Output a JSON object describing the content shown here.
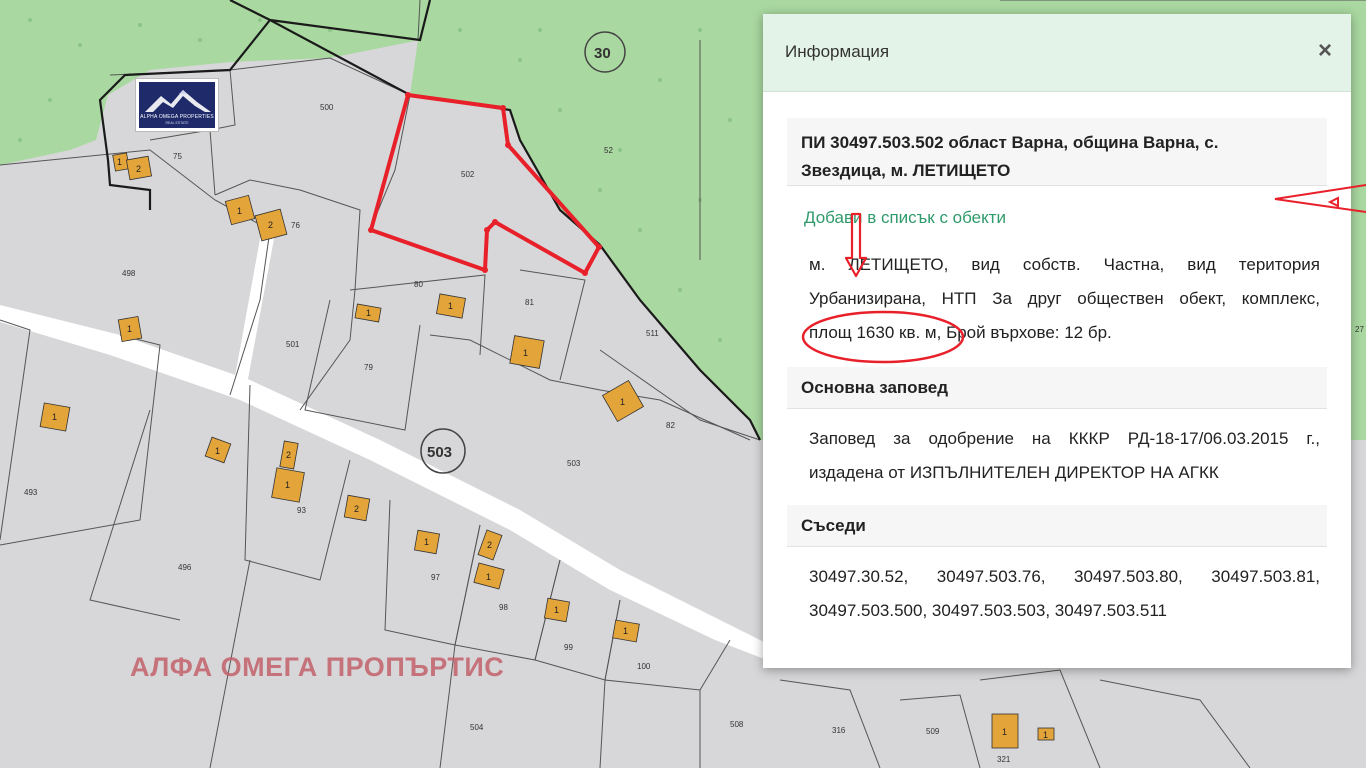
{
  "map": {
    "labels": {
      "quarter_30": "30",
      "quarter_503": "503",
      "parcel_500": "500",
      "parcel_502": "502",
      "parcel_52": "52",
      "parcel_75": "75",
      "parcel_76": "76",
      "parcel_498": "498",
      "parcel_80": "80",
      "parcel_81": "81",
      "parcel_511": "511",
      "parcel_501": "501",
      "parcel_79": "79",
      "parcel_82": "82",
      "parcel_503": "503",
      "parcel_493": "493",
      "parcel_93": "93",
      "parcel_496": "496",
      "parcel_97": "97",
      "parcel_98": "98",
      "parcel_99": "99",
      "parcel_100": "100",
      "parcel_504": "504",
      "parcel_508": "508",
      "parcel_316": "316",
      "parcel_509": "509",
      "parcel_321": "321",
      "edge_27": "27",
      "bld_1": "1",
      "bld_2": "2"
    },
    "colors": {
      "forest": "#a9d8a0",
      "parcel": "#d7d7d9",
      "building": "#e3a43a",
      "highlight": "#e8202a"
    }
  },
  "logo": {
    "name": "ALPHA OMEGA PROPERTIES",
    "sub": "REAL ESTATE"
  },
  "watermark": "АЛФА ОМЕГА ПРОПЪРТИС",
  "panel": {
    "title": "Информация",
    "close": "×",
    "parcel_title_line1": "ПИ 30497.503.502 област Варна, община Варна, с.",
    "parcel_title_line2": "Звездица, м. ЛЕТИЩЕТО",
    "add_link": "Добави в списък с обекти",
    "details_line1": "м. ЛЕТИЩЕТО, вид собств. Частна, вид територия",
    "details_line2": "Урбанизирана, НТП За друг обществен обект, комплекс,",
    "details_line3": "площ 1630 кв. м, Брой върхове: 12 бр.",
    "order_head": "Основна заповед",
    "order_line1": "Заповед за одобрение на КККР РД-18-17/06.03.2015 г.,",
    "order_line2": "издадена от ИЗПЪЛНИТЕЛЕН ДИРЕКТОР НА АГКК",
    "neighbors_head": "Съседи",
    "neighbors_line1": "30497.30.52, 30497.503.76, 30497.503.80, 30497.503.81,",
    "neighbors_line2": "30497.503.500, 30497.503.503, 30497.503.511"
  }
}
